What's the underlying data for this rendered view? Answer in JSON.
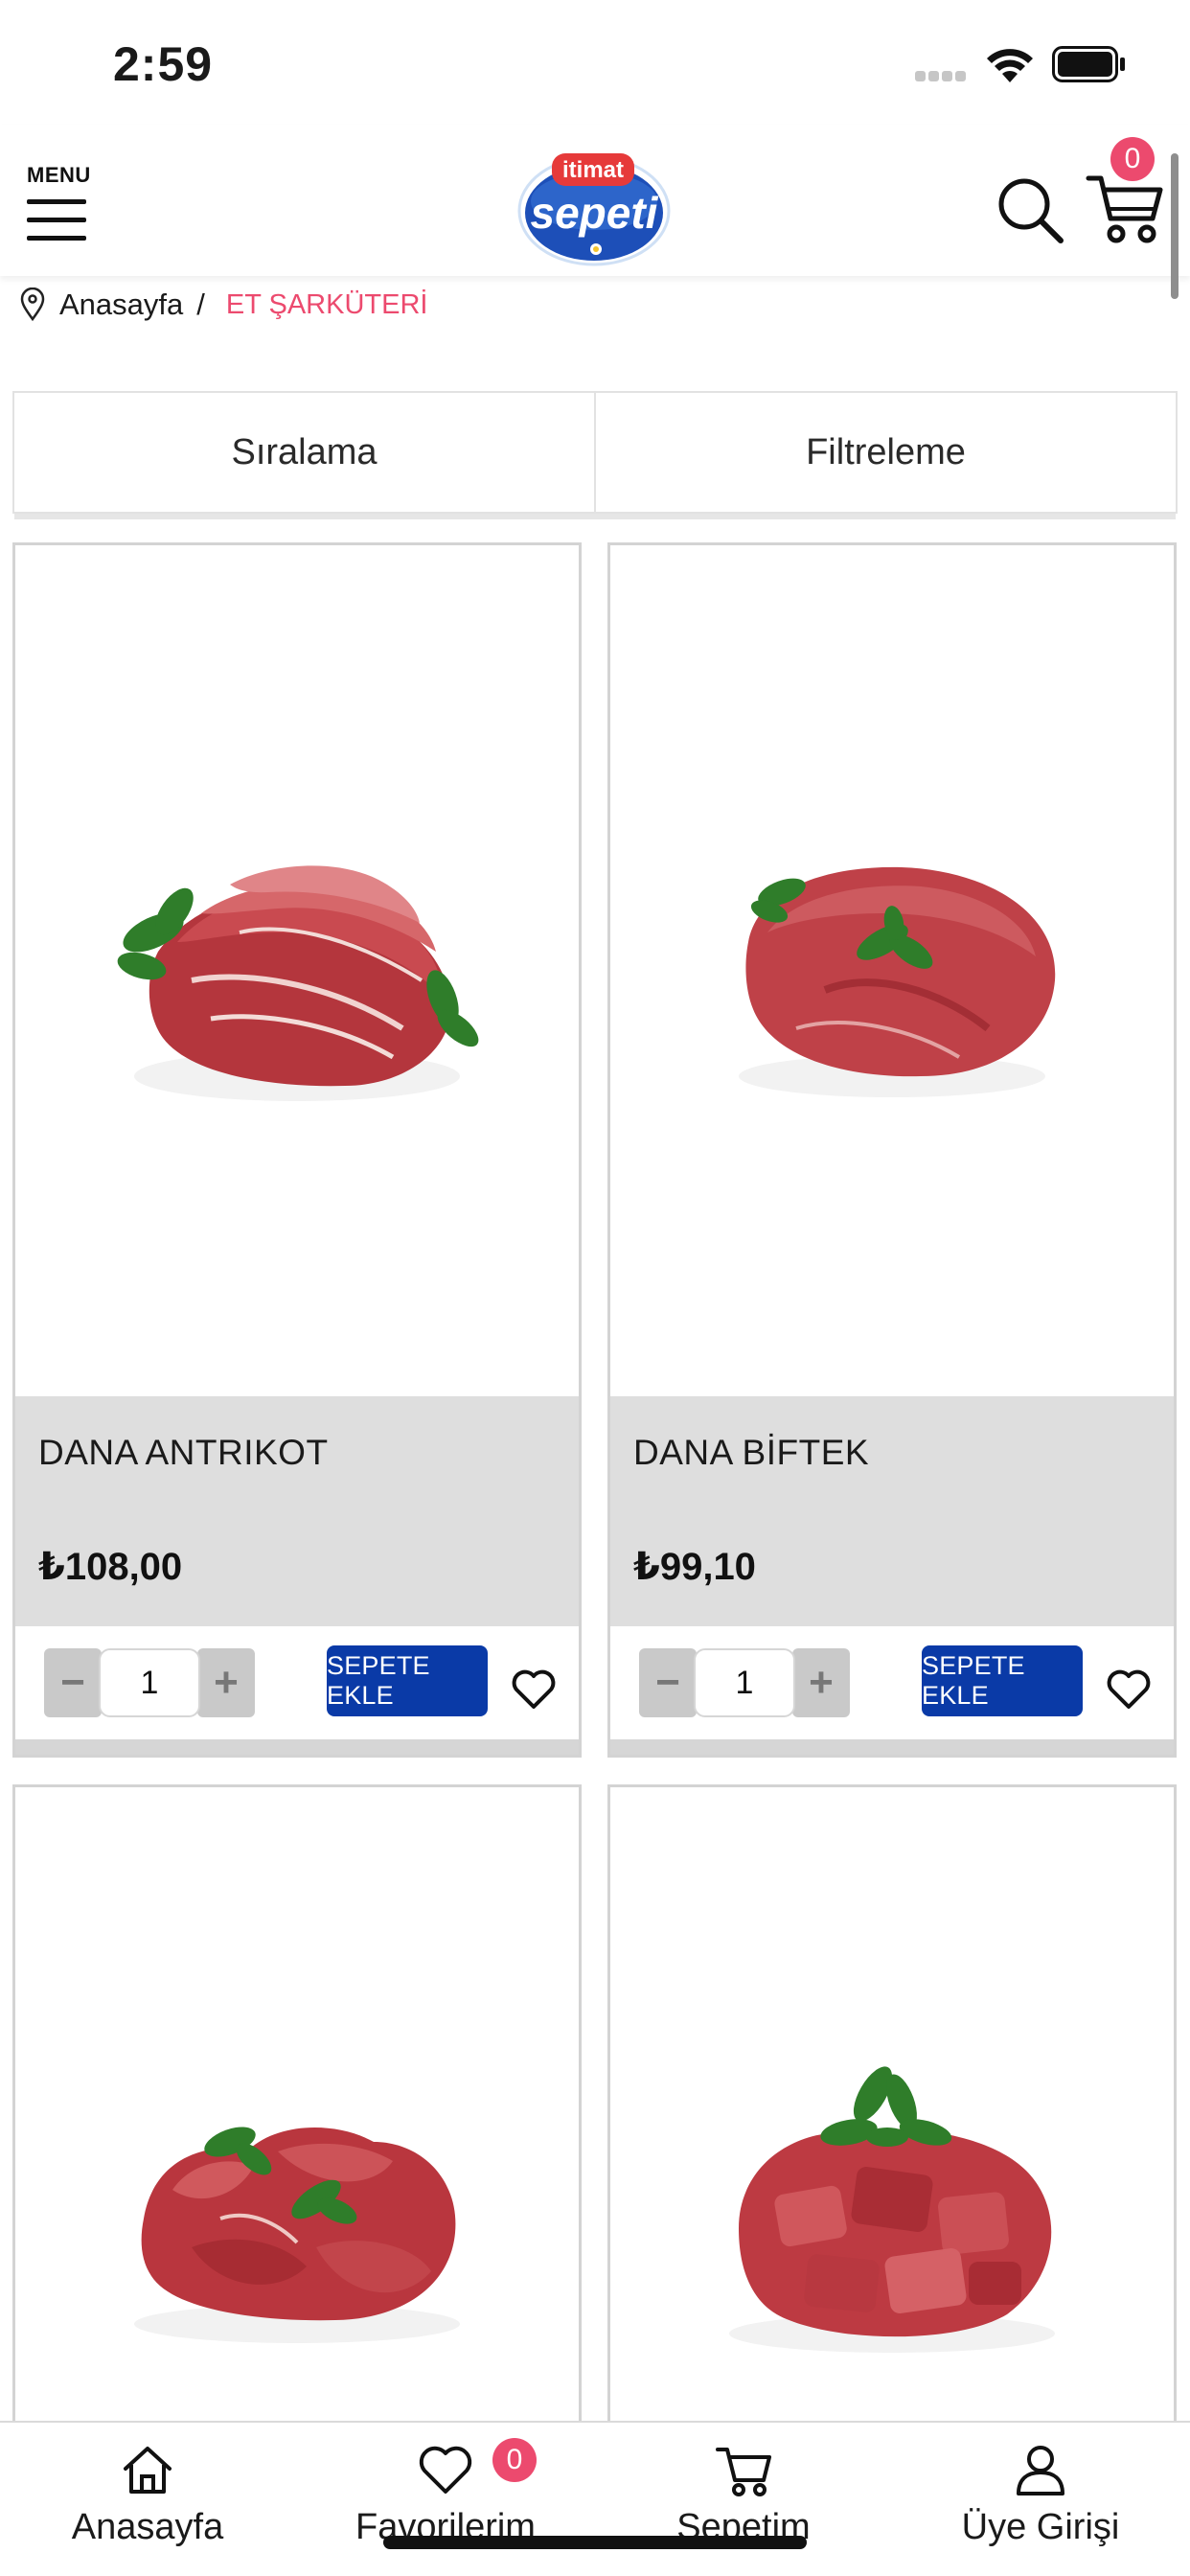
{
  "status_bar": {
    "time": "2:59"
  },
  "header": {
    "menu_label": "MENU",
    "logo_top": "itimat",
    "logo_main": "sepeti",
    "cart_count": "0"
  },
  "breadcrumb": {
    "home": "Anasayfa",
    "separator": "/",
    "current": "ET ŞARKÜTERİ"
  },
  "toolbar": {
    "sort_label": "Sıralama",
    "filter_label": "Filtreleme"
  },
  "products": [
    {
      "name": "DANA ANTRIKOT",
      "price": "₺108,00",
      "quantity": "1",
      "add_label": "SEPETE EKLE"
    },
    {
      "name": "DANA BİFTEK",
      "price": "₺99,10",
      "quantity": "1",
      "add_label": "SEPETE EKLE"
    },
    {
      "name": "",
      "price": ""
    },
    {
      "name": "",
      "price": ""
    }
  ],
  "bottom_nav": {
    "home": "Anasayfa",
    "favorites": "Favorilerim",
    "favorites_count": "0",
    "cart": "Sepetim",
    "account": "Üye Girişi"
  },
  "colors": {
    "accent": "#ec4a6e",
    "button": "#0a3aa7",
    "info_bg": "#dedede"
  },
  "icons": [
    "menu-icon",
    "search-icon",
    "cart-icon",
    "location-pin-icon",
    "minus-icon",
    "plus-icon",
    "heart-icon",
    "home-icon",
    "user-icon"
  ]
}
